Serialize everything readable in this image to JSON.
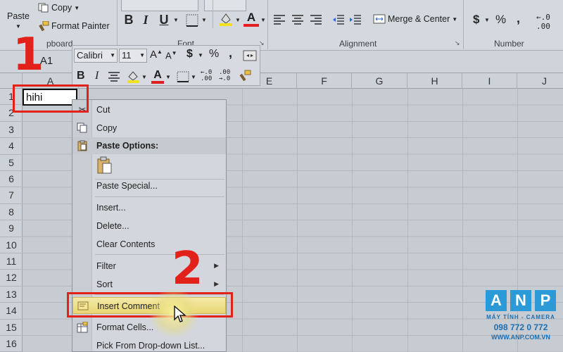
{
  "ribbon": {
    "paste_label": "Paste",
    "copy_label": "Copy",
    "format_painter_label": "Format Painter",
    "clipboard_label": "pboard",
    "font_label": "Font",
    "alignment_label": "Alignment",
    "merge_center_label": "Merge & Center",
    "number_label": "Number",
    "bold": "B",
    "italic": "I",
    "underline": "U",
    "font_color_glyph": "A",
    "currency": "$",
    "percent": "%",
    "font_color": "#e02020",
    "fill_color": "#f0e020"
  },
  "formula_bar": {
    "name_box": "A1"
  },
  "sheet": {
    "columns": [
      "A",
      "E",
      "F",
      "G",
      "H",
      "I",
      "J"
    ],
    "rows": [
      "1",
      "2",
      "3",
      "4",
      "5",
      "6",
      "7",
      "8",
      "9",
      "10",
      "11",
      "12",
      "13",
      "14",
      "15",
      "16"
    ],
    "cell_a1": "hihi"
  },
  "mini_toolbar": {
    "font_name": "Calibri",
    "font_size": "11",
    "bold": "B",
    "italic": "I",
    "font_color_glyph": "A",
    "currency": "$",
    "percent": "%"
  },
  "context_menu": {
    "items": [
      {
        "label": "Cut",
        "icon": "scissors-icon"
      },
      {
        "label": "Copy",
        "icon": "copy-icon"
      },
      {
        "label": "Paste Options:",
        "icon": "clipboard-icon"
      },
      {
        "label": "Paste Special...",
        "icon": ""
      },
      {
        "label": "Insert...",
        "icon": ""
      },
      {
        "label": "Delete...",
        "icon": ""
      },
      {
        "label": "Clear Contents",
        "icon": ""
      },
      {
        "label": "Filter",
        "icon": ""
      },
      {
        "label": "Sort",
        "icon": ""
      },
      {
        "label": "Insert Comment",
        "icon": "comment-icon"
      },
      {
        "label": "Format Cells...",
        "icon": "format-cells-icon"
      },
      {
        "label": "Pick From Drop-down List...",
        "icon": ""
      }
    ]
  },
  "annotations": {
    "step1": "1",
    "step2": "2",
    "accent": "#e3211b"
  },
  "watermark": {
    "letters": [
      "A",
      "N",
      "P"
    ],
    "line1": "MÁY TÍNH - CAMERA",
    "line2": "098 772 0 772",
    "line3": "WWW.ANP.COM.VN",
    "color": "#2b9ad6"
  }
}
